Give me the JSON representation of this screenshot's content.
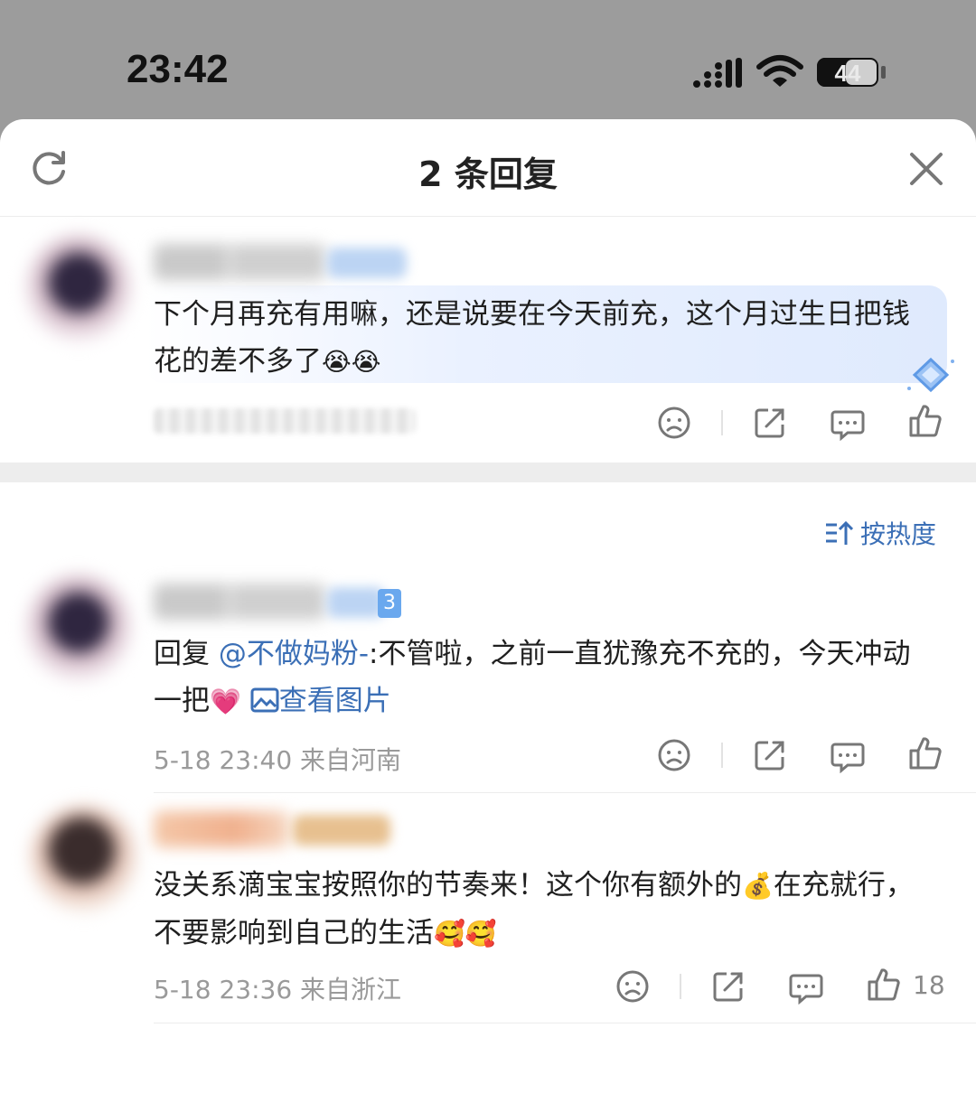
{
  "status_bar": {
    "time": "23:42",
    "battery_level": "44"
  },
  "header": {
    "title": "2 条回复"
  },
  "sort": {
    "label": "按热度"
  },
  "comments": [
    {
      "text": "下个月再充有用嘛，还是说要在今天前充，这个月过生日把钱",
      "text_line2": "花的差不多了",
      "emoji": "😭😭"
    },
    {
      "badge_peek": "3",
      "reply_prefix": "回复 ",
      "mention": "@不做妈粉-",
      "text": ":不管啦，之前一直犹豫充不充的，今天冲动",
      "text_line2": "一把",
      "emoji": "💗",
      "image_link": "查看图片",
      "meta": "5-18 23:40 来自河南"
    },
    {
      "text": "没关系滴宝宝按照你的节奏来！这个你有额外的",
      "money_emoji": "💰",
      "text_after_emoji": "在充就行，",
      "text_line2": "不要影响到自己的生活",
      "emoji": "🥰🥰",
      "meta": "5-18 23:36 来自浙江",
      "likes": "18"
    }
  ]
}
